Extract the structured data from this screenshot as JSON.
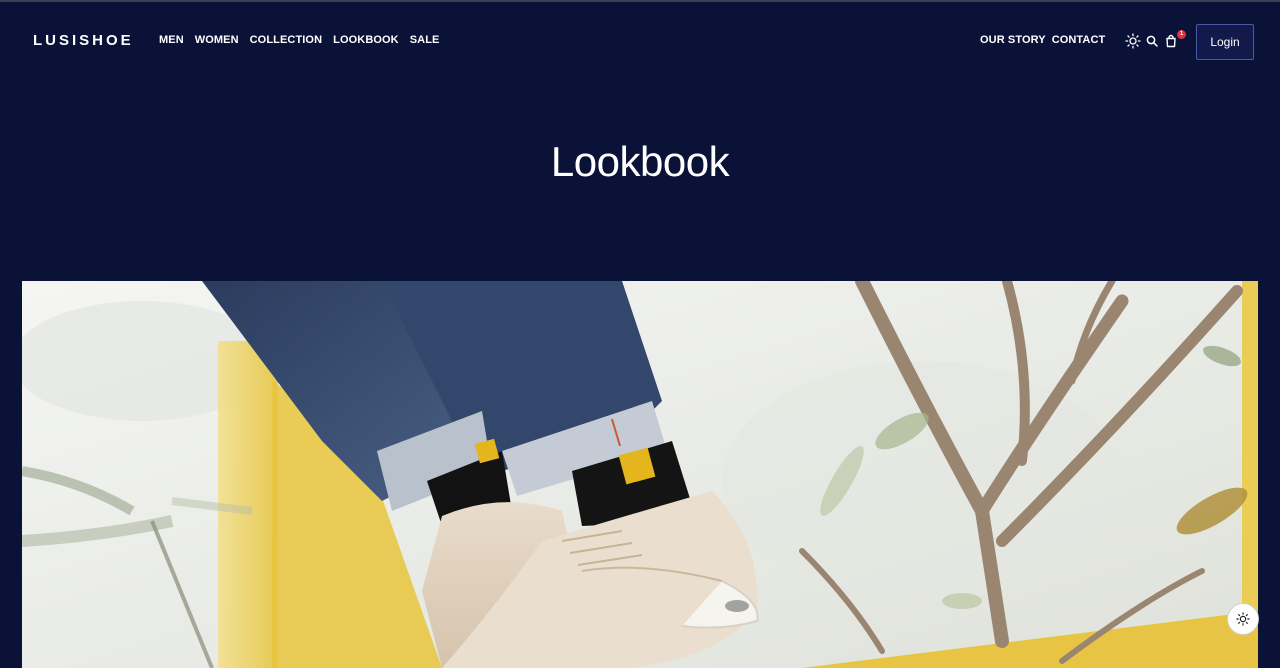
{
  "brand": {
    "name": "LUSISHOE"
  },
  "nav": {
    "left": [
      {
        "label": "MEN"
      },
      {
        "label": "WOMEN"
      },
      {
        "label": "COLLECTION"
      },
      {
        "label": "LOOKBOOK"
      },
      {
        "label": "SALE"
      }
    ],
    "right": [
      {
        "label": "OUR STORY"
      },
      {
        "label": "CONTACT"
      }
    ]
  },
  "header_icons": {
    "theme": "sun-icon",
    "search": "search-icon",
    "cart": "shopping-bag-icon",
    "cart_count": "1"
  },
  "login": {
    "label": "Login"
  },
  "page": {
    "title": "Lookbook"
  },
  "hero_image": {
    "subject": "photo"
  },
  "floating": {
    "icon": "sun-icon"
  },
  "colors": {
    "background": "#0b1238",
    "text": "#ffffff",
    "badge": "#e0303a",
    "login_border": "#4a5aa8"
  }
}
